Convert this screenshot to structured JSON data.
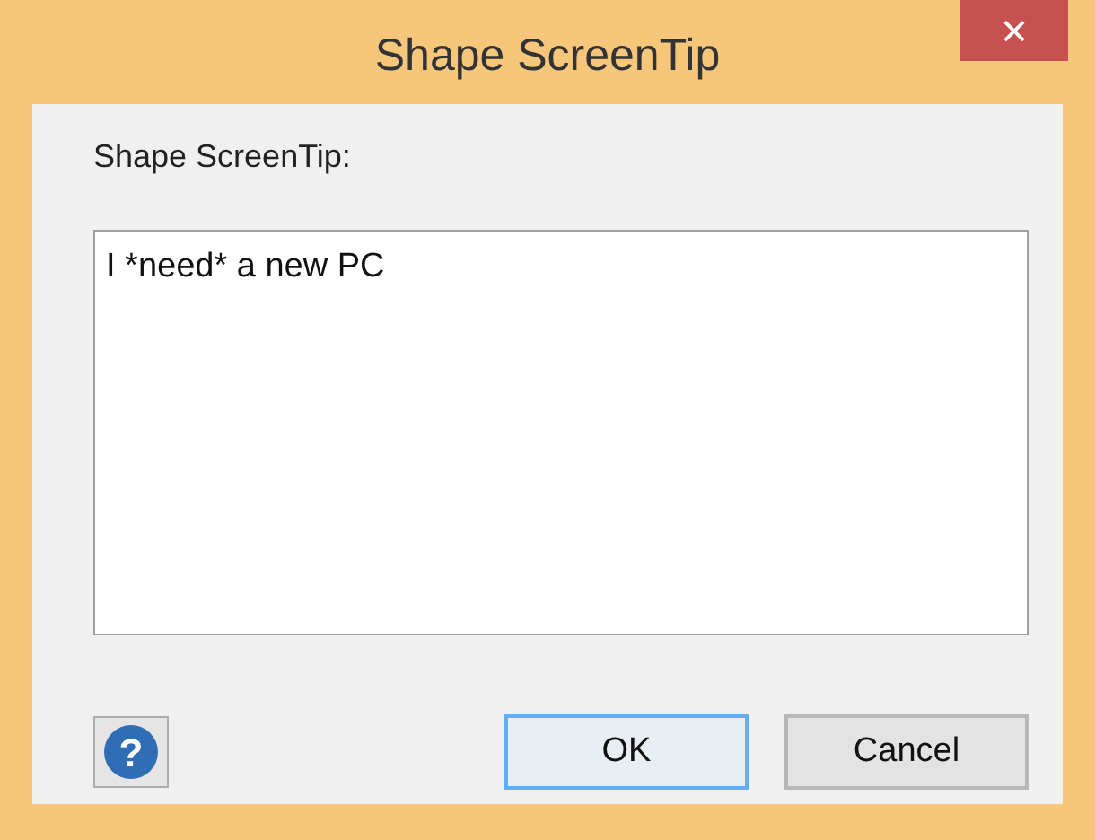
{
  "window": {
    "title": "Shape ScreenTip",
    "close": "×"
  },
  "field": {
    "label": "Shape ScreenTip:",
    "value": "I *need* a new PC"
  },
  "buttons": [
    {
      "kind": "help",
      "label": "?"
    },
    {
      "kind": "text",
      "label": "OK",
      "default": true
    },
    {
      "kind": "text",
      "label": "Cancel",
      "default": false
    }
  ]
}
